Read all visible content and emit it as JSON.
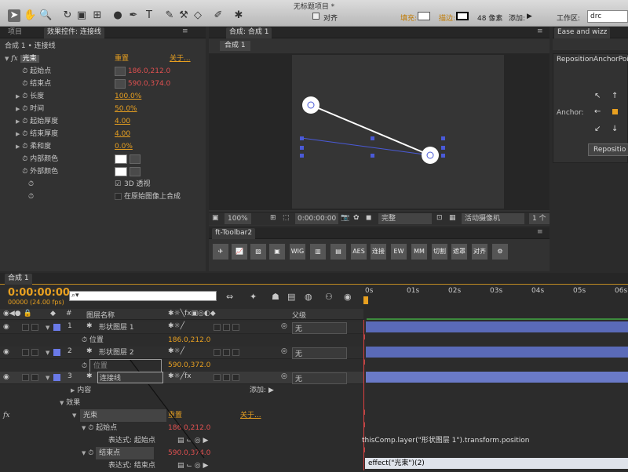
{
  "window": {
    "title": "无标题项目 *"
  },
  "toolbar": {
    "align_label": "对齐",
    "fill_label": "填充:",
    "stroke_label": "描边:",
    "stroke_size": "48 像素",
    "add_label": "添加:",
    "workspace_label": "工作区:",
    "workspace_value": "drc"
  },
  "effect_panel": {
    "tabs": [
      "项目",
      "效果控件: 连接线"
    ],
    "breadcrumb": "合成 1 • 连接线",
    "fx_name": "光束",
    "reset": "重置",
    "about": "关于...",
    "props": [
      {
        "label": "起始点",
        "value": "186.0,212.0",
        "style": "red"
      },
      {
        "label": "结束点",
        "value": "590.0,374.0",
        "style": "red"
      },
      {
        "label": "长度",
        "value": "100.0%",
        "style": "orange"
      },
      {
        "label": "时间",
        "value": "50.0%",
        "style": "orange"
      },
      {
        "label": "起始厚度",
        "value": "4.00",
        "style": "orange"
      },
      {
        "label": "结束厚度",
        "value": "4.00",
        "style": "orange"
      },
      {
        "label": "柔和度",
        "value": "0.0%",
        "style": "orange"
      },
      {
        "label": "内部颜色",
        "value": "",
        "style": "swatch"
      },
      {
        "label": "外部颜色",
        "value": "",
        "style": "swatch"
      }
    ],
    "check_3d": "3D 透视",
    "check_composite": "在原始图像上合成"
  },
  "comp_panel": {
    "tab": "合成: 合成 1",
    "subtab": "合成 1",
    "zoom": "100%",
    "timecode": "0:00:00:00",
    "quality": "完整",
    "camera": "活动摄像机",
    "views": "1 个"
  },
  "toolbar2": {
    "tab": "ft-Toolbar2",
    "buttons": [
      "WIG",
      "AES",
      "连接",
      "EW",
      "MM",
      "切割",
      "遮罩",
      "对齐"
    ]
  },
  "ease_panel": {
    "tab": "Ease and wizz"
  },
  "reposition_panel": {
    "title": "RepositionAnchorPoi",
    "anchor_label": "Anchor:",
    "button": "Repositio"
  },
  "timeline": {
    "tab": "合成 1",
    "timecode": "0:00:00:00",
    "fps": "00000 (24.00 fps)",
    "col_name": "图层名称",
    "col_parent": "父级",
    "ruler": [
      "0s",
      "01s",
      "02s",
      "03s",
      "04s",
      "05s",
      "06s"
    ],
    "layers": [
      {
        "num": "1",
        "name": "形状图层 1",
        "color": "#6a7ae8",
        "parent": "无",
        "pos_label": "位置",
        "pos_value": "186.0,212.0"
      },
      {
        "num": "2",
        "name": "形状图层 2",
        "color": "#6a7ae8",
        "parent": "无",
        "pos_label": "位置",
        "pos_value": "590.0,372.0"
      },
      {
        "num": "3",
        "name": "连接线",
        "color": "#6a7ae8",
        "parent": "无"
      }
    ],
    "content_label": "内容",
    "add_label": "添加:",
    "effects_label": "效果",
    "fx_name": "光束",
    "reset": "重置",
    "about": "关于...",
    "start_label": "起始点",
    "start_value": "186.0,212.0",
    "expr_start": "表达式: 起始点",
    "end_label": "结束点",
    "end_value": "590.0,374.0",
    "expr_end": "表达式: 结束点",
    "expr_text1": "thisComp.layer(\"形状图层 1\").transform.position",
    "expr_text2": "effect(\"光束\")(2)"
  }
}
